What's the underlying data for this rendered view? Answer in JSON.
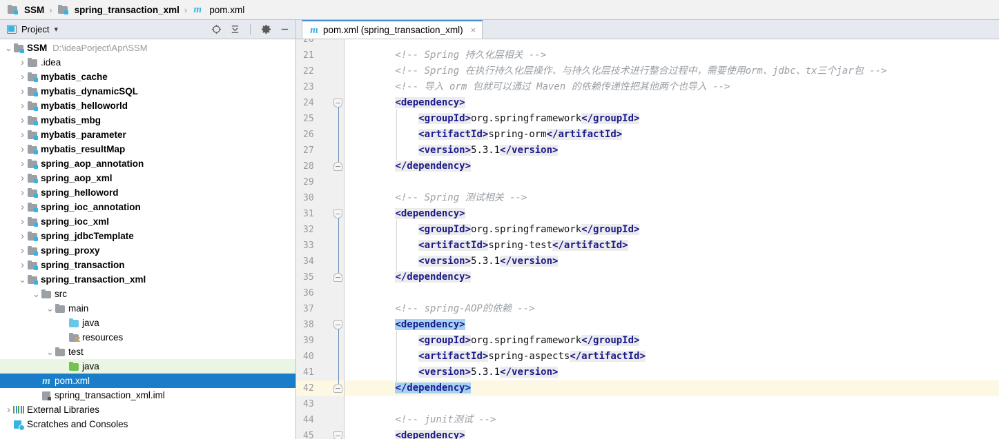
{
  "breadcrumb": {
    "items": [
      {
        "label": "SSM",
        "icon": "module-folder-icon",
        "bold": true
      },
      {
        "label": "spring_transaction_xml",
        "icon": "module-folder-icon",
        "bold": true
      },
      {
        "label": "pom.xml",
        "icon": "maven-m-icon",
        "bold": false
      }
    ],
    "separator": "›"
  },
  "project_panel": {
    "title": "Project",
    "dropdown_glyph": "▾",
    "toolbar_icons": [
      {
        "name": "locate-in-tree-icon",
        "glyph": "⊕"
      },
      {
        "name": "collapse-all-icon",
        "glyph": "⤓"
      },
      {
        "name": "settings-gear-icon",
        "glyph": "⚙"
      },
      {
        "name": "hide-panel-icon",
        "glyph": "—"
      }
    ],
    "tree": [
      {
        "label": "SSM",
        "path": "D:\\ideaPorject\\Apr\\SSM",
        "indent": 0,
        "twist": "v",
        "icon": "module-folder-icon",
        "bold": true
      },
      {
        "label": ".idea",
        "indent": 1,
        "twist": ">",
        "icon": "folder-icon"
      },
      {
        "label": "mybatis_cache",
        "indent": 1,
        "twist": ">",
        "icon": "module-folder-icon",
        "bold": true
      },
      {
        "label": "mybatis_dynamicSQL",
        "indent": 1,
        "twist": ">",
        "icon": "module-folder-icon",
        "bold": true
      },
      {
        "label": "mybatis_helloworld",
        "indent": 1,
        "twist": ">",
        "icon": "module-folder-icon",
        "bold": true
      },
      {
        "label": "mybatis_mbg",
        "indent": 1,
        "twist": ">",
        "icon": "module-folder-icon",
        "bold": true
      },
      {
        "label": "mybatis_parameter",
        "indent": 1,
        "twist": ">",
        "icon": "module-folder-icon",
        "bold": true
      },
      {
        "label": "mybatis_resultMap",
        "indent": 1,
        "twist": ">",
        "icon": "module-folder-icon",
        "bold": true
      },
      {
        "label": "spring_aop_annotation",
        "indent": 1,
        "twist": ">",
        "icon": "module-folder-icon",
        "bold": true
      },
      {
        "label": "spring_aop_xml",
        "indent": 1,
        "twist": ">",
        "icon": "module-folder-icon",
        "bold": true
      },
      {
        "label": "spring_helloword",
        "indent": 1,
        "twist": ">",
        "icon": "module-folder-icon",
        "bold": true
      },
      {
        "label": "spring_ioc_annotation",
        "indent": 1,
        "twist": ">",
        "icon": "module-folder-icon",
        "bold": true
      },
      {
        "label": "spring_ioc_xml",
        "indent": 1,
        "twist": ">",
        "icon": "module-folder-icon",
        "bold": true
      },
      {
        "label": "spring_jdbcTemplate",
        "indent": 1,
        "twist": ">",
        "icon": "module-folder-icon",
        "bold": true
      },
      {
        "label": "spring_proxy",
        "indent": 1,
        "twist": ">",
        "icon": "module-folder-icon",
        "bold": true
      },
      {
        "label": "spring_transaction",
        "indent": 1,
        "twist": ">",
        "icon": "module-folder-icon",
        "bold": true
      },
      {
        "label": "spring_transaction_xml",
        "indent": 1,
        "twist": "v",
        "icon": "module-folder-icon",
        "bold": true
      },
      {
        "label": "src",
        "indent": 2,
        "twist": "v",
        "icon": "folder-icon"
      },
      {
        "label": "main",
        "indent": 3,
        "twist": "v",
        "icon": "folder-icon"
      },
      {
        "label": "java",
        "indent": 4,
        "twist": "",
        "icon": "source-folder-blue-icon"
      },
      {
        "label": "resources",
        "indent": 4,
        "twist": "",
        "icon": "resources-folder-icon"
      },
      {
        "label": "test",
        "indent": 3,
        "twist": "v",
        "icon": "folder-icon"
      },
      {
        "label": "java",
        "indent": 4,
        "twist": "",
        "icon": "test-source-folder-green-icon",
        "row_style": "green"
      },
      {
        "label": "pom.xml",
        "indent": 2,
        "twist": "",
        "icon": "maven-m-icon",
        "row_style": "selected"
      },
      {
        "label": "spring_transaction_xml.iml",
        "indent": 2,
        "twist": "",
        "icon": "iml-file-icon"
      },
      {
        "label": "External Libraries",
        "indent": 0,
        "twist": ">",
        "icon": "libraries-icon"
      },
      {
        "label": "Scratches and Consoles",
        "indent": 0,
        "twist": "",
        "icon": "scratches-icon"
      }
    ]
  },
  "editor": {
    "tab": {
      "label": "pom.xml (spring_transaction_xml)",
      "icon": "maven-m-icon",
      "close_glyph": "×"
    },
    "first_visible_line": 21,
    "caret_line": 42,
    "lines": [
      {
        "n": 20,
        "partial": true,
        "segments": []
      },
      {
        "n": 21,
        "segments": [
          {
            "t": "cmt",
            "s": "        <!-- Spring 持久化层相关 -->"
          }
        ]
      },
      {
        "n": 22,
        "segments": [
          {
            "t": "cmt",
            "s": "        <!-- Spring 在执行持久化层操作、与持久化层技术进行整合过程中，需要使用orm、jdbc、tx三个jar包 -->"
          }
        ]
      },
      {
        "n": 23,
        "segments": [
          {
            "t": "cmt",
            "s": "        <!-- 导入 orm 包就可以通过 Maven 的依赖传递性把其他两个也导入 -->"
          }
        ]
      },
      {
        "n": 24,
        "fold": "down",
        "segments": [
          {
            "t": "txt",
            "s": "        "
          },
          {
            "t": "tag",
            "s": "<dependency>"
          }
        ]
      },
      {
        "n": 25,
        "segments": [
          {
            "t": "txt",
            "s": "            "
          },
          {
            "t": "tag",
            "s": "<groupId>"
          },
          {
            "t": "txt",
            "s": "org.springframework"
          },
          {
            "t": "tag",
            "s": "</groupId>"
          }
        ]
      },
      {
        "n": 26,
        "segments": [
          {
            "t": "txt",
            "s": "            "
          },
          {
            "t": "tag",
            "s": "<artifactId>"
          },
          {
            "t": "txt",
            "s": "spring-orm"
          },
          {
            "t": "tag",
            "s": "</artifactId>"
          }
        ]
      },
      {
        "n": 27,
        "segments": [
          {
            "t": "txt",
            "s": "            "
          },
          {
            "t": "tag",
            "s": "<version>"
          },
          {
            "t": "txt",
            "s": "5.3.1"
          },
          {
            "t": "tag",
            "s": "</version>"
          }
        ]
      },
      {
        "n": 28,
        "fold": "up",
        "segments": [
          {
            "t": "txt",
            "s": "        "
          },
          {
            "t": "tag",
            "s": "</dependency>"
          }
        ]
      },
      {
        "n": 29,
        "segments": []
      },
      {
        "n": 30,
        "segments": [
          {
            "t": "cmt",
            "s": "        <!-- Spring 测试相关 -->"
          }
        ]
      },
      {
        "n": 31,
        "fold": "down",
        "segments": [
          {
            "t": "txt",
            "s": "        "
          },
          {
            "t": "tag",
            "s": "<dependency>"
          }
        ]
      },
      {
        "n": 32,
        "segments": [
          {
            "t": "txt",
            "s": "            "
          },
          {
            "t": "tag",
            "s": "<groupId>"
          },
          {
            "t": "txt",
            "s": "org.springframework"
          },
          {
            "t": "tag",
            "s": "</groupId>"
          }
        ]
      },
      {
        "n": 33,
        "segments": [
          {
            "t": "txt",
            "s": "            "
          },
          {
            "t": "tag",
            "s": "<artifactId>"
          },
          {
            "t": "txt",
            "s": "spring-test"
          },
          {
            "t": "tag",
            "s": "</artifactId>"
          }
        ]
      },
      {
        "n": 34,
        "segments": [
          {
            "t": "txt",
            "s": "            "
          },
          {
            "t": "tag",
            "s": "<version>"
          },
          {
            "t": "txt",
            "s": "5.3.1"
          },
          {
            "t": "tag",
            "s": "</version>"
          }
        ]
      },
      {
        "n": 35,
        "fold": "up",
        "segments": [
          {
            "t": "txt",
            "s": "        "
          },
          {
            "t": "tag",
            "s": "</dependency>"
          }
        ]
      },
      {
        "n": 36,
        "segments": []
      },
      {
        "n": 37,
        "segments": [
          {
            "t": "cmt",
            "s": "        <!-- spring-AOP的依赖 -->"
          }
        ]
      },
      {
        "n": 38,
        "fold": "down",
        "segments": [
          {
            "t": "txt",
            "s": "        "
          },
          {
            "t": "tag hl",
            "s": "<dependency>"
          }
        ]
      },
      {
        "n": 39,
        "segments": [
          {
            "t": "txt",
            "s": "            "
          },
          {
            "t": "tag",
            "s": "<groupId>"
          },
          {
            "t": "txt",
            "s": "org.springframework"
          },
          {
            "t": "tag",
            "s": "</groupId>"
          }
        ]
      },
      {
        "n": 40,
        "segments": [
          {
            "t": "txt",
            "s": "            "
          },
          {
            "t": "tag",
            "s": "<artifactId>"
          },
          {
            "t": "txt",
            "s": "spring-aspects"
          },
          {
            "t": "tag",
            "s": "</artifactId>"
          }
        ]
      },
      {
        "n": 41,
        "segments": [
          {
            "t": "txt",
            "s": "            "
          },
          {
            "t": "tag",
            "s": "<version>"
          },
          {
            "t": "txt",
            "s": "5.3.1"
          },
          {
            "t": "tag",
            "s": "</version>"
          }
        ]
      },
      {
        "n": 42,
        "fold": "up",
        "caret": true,
        "segments": [
          {
            "t": "txt",
            "s": "        "
          },
          {
            "t": "tag hl",
            "s": "</dependency>"
          }
        ]
      },
      {
        "n": 43,
        "segments": []
      },
      {
        "n": 44,
        "segments": [
          {
            "t": "cmt",
            "s": "        <!-- junit测试 -->"
          }
        ]
      },
      {
        "n": 45,
        "fold": "down",
        "segments": [
          {
            "t": "txt",
            "s": "        "
          },
          {
            "t": "tag",
            "s": "<dependency>"
          }
        ]
      }
    ]
  },
  "colors": {
    "selection_blue": "#1a7dc9",
    "tag_navy": "#1a1a8c",
    "comment_gray": "#9aa0a6",
    "caret_row_yellow": "#fdf8e3",
    "match_tag_blue": "#a6d2f4",
    "test_source_green": "#eaf5e4",
    "toolbar_bg": "#e6e9ef",
    "gutter_bg": "#f0f0f0"
  }
}
